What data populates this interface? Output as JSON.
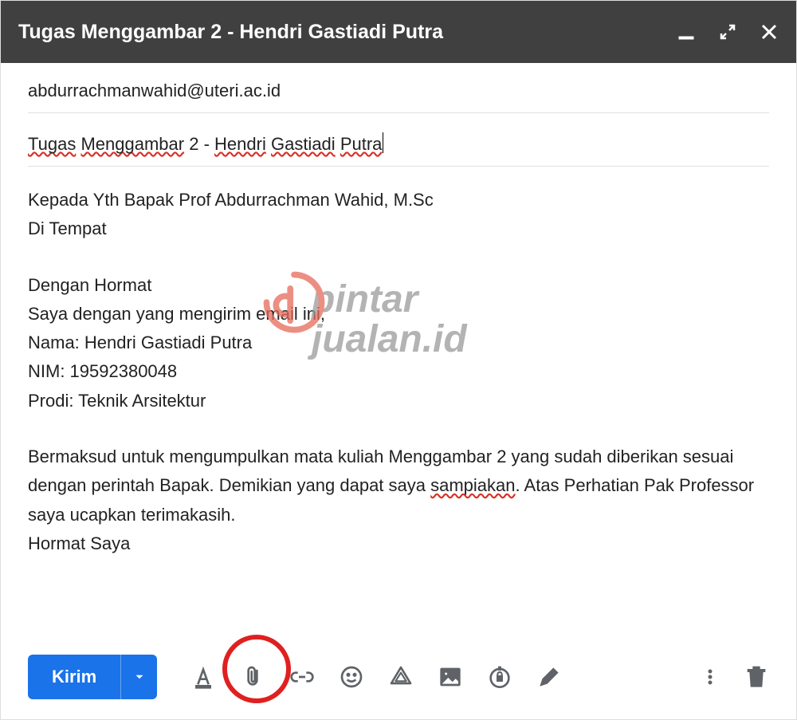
{
  "header": {
    "title": "Tugas Menggambar 2 - Hendri Gastiadi Putra"
  },
  "fields": {
    "to": "abdurrachmanwahid@uteri.ac.id",
    "subject_parts": {
      "w1": "Tugas",
      "s1": " ",
      "w2": "Menggambar",
      "s2": " ",
      "w3": "2",
      "s3": " - ",
      "w4": "Hendri",
      "s4": " ",
      "w5": "Gastiadi",
      "s5": " ",
      "w6": "Putra"
    }
  },
  "body": {
    "greet1": "Kepada Yth Bapak Prof Abdurrachman Wahid, M.Sc",
    "greet2": "Di Tempat",
    "intro1": "Dengan Hormat",
    "intro2": "Saya dengan yang mengirim email ini,",
    "nama": "Nama: Hendri Gastiadi Putra",
    "nim": "NIM: 19592380048",
    "prodi": "Prodi: Teknik Arsitektur",
    "para_a": "Bermaksud untuk mengumpulkan mata kuliah Menggambar 2 yang sudah diberikan sesuai dengan perintah Bapak. Demikian yang dapat saya ",
    "para_spell": "sampiakan",
    "para_b": ". Atas Perhatian Pak Professor saya ucapkan terimakasih.",
    "signoff": "Hormat Saya"
  },
  "toolbar": {
    "send_label": "Kirim"
  },
  "watermark": {
    "line1": "pintar",
    "line2": "jualan.id"
  }
}
